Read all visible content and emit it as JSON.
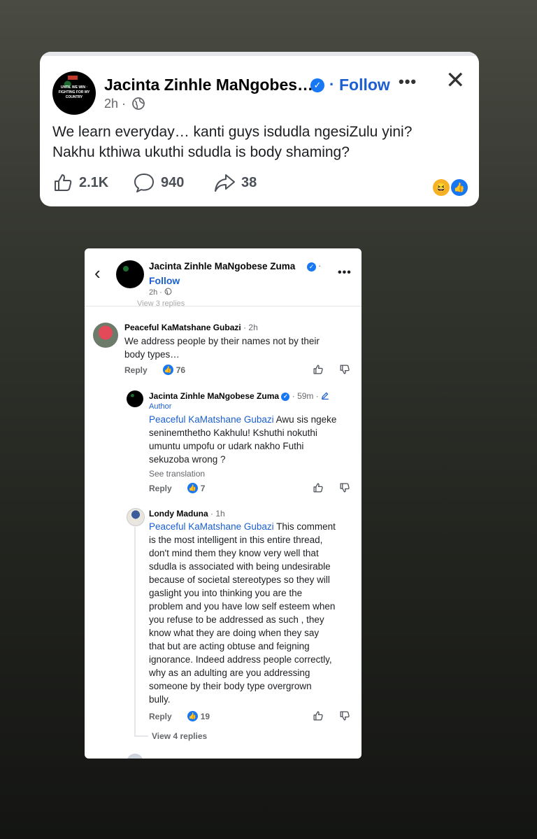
{
  "post": {
    "author": "Jacinta Zinhle MaNgobes…",
    "follow": "Follow",
    "more": "•••",
    "close": "✕",
    "time": "2h ·",
    "text_line1": "We learn everyday… kanti guys isdudla ngesiZulu yini?",
    "text_line2": "Nakhu kthiwa ukuthi sdudla is body shaming?",
    "likes": "2.1K",
    "comments": "940",
    "shares": "38",
    "avatar_text": "UNTIL WE WIN · FIGHTING FOR MY COUNTRY"
  },
  "comments_view": {
    "header": {
      "author": "Jacinta Zinhle MaNgobese Zuma",
      "follow": "Follow",
      "time": "2h ·",
      "more": "•••",
      "ghost": "View 3 replies"
    },
    "comments": [
      {
        "author": "Peaceful KaMatshane Gubazi",
        "time": "· 2h",
        "text_line1": "We address people by their names not by their",
        "text_line2": "body types…",
        "reply": "Reply",
        "likes": "76"
      },
      {
        "author": "Jacinta Zinhle MaNgobese Zuma",
        "time": "· 59m ·",
        "badge": "Author",
        "mention": "Peaceful KaMatshane Gubazi",
        "lines": [
          "Awu sis ngeke",
          "seninemthetho Kakhulu! Kshuthi nokuthi",
          "umuntu umpofu or udark nakho Futhi",
          "sekuzoba wrong ?"
        ],
        "see_translation": "See translation",
        "reply": "Reply",
        "likes": "7"
      },
      {
        "author": "Londy Maduna",
        "time": "· 1h",
        "mention": "Peaceful KaMatshane Gubazi",
        "lines": [
          "This comment",
          "is the most intelligent in this entire thread,",
          "don't mind them they know very well that",
          "sdudla is associated with being undesirable",
          "because of societal stereotypes so they will",
          "gaslight you into thinking you are the",
          "problem and you have low self esteem when",
          "you refuse to be addressed as such , they",
          "know what they are doing when they say",
          "that but are acting obtuse and feigning",
          "ignorance. Indeed address people correctly,",
          "why as an adulting are you addressing",
          "someone by their body type overgrown",
          "bully."
        ],
        "reply": "Reply",
        "likes": "19",
        "view_replies": "View 4 replies"
      }
    ]
  },
  "colors": {
    "accent": "#1b5fd0",
    "like": "#1877f2",
    "haha": "#f7b125"
  },
  "icons": [
    "globe-icon",
    "like-icon",
    "comment-icon",
    "share-icon",
    "back-icon",
    "thumbs-up-icon",
    "thumbs-down-icon",
    "edit-icon"
  ]
}
